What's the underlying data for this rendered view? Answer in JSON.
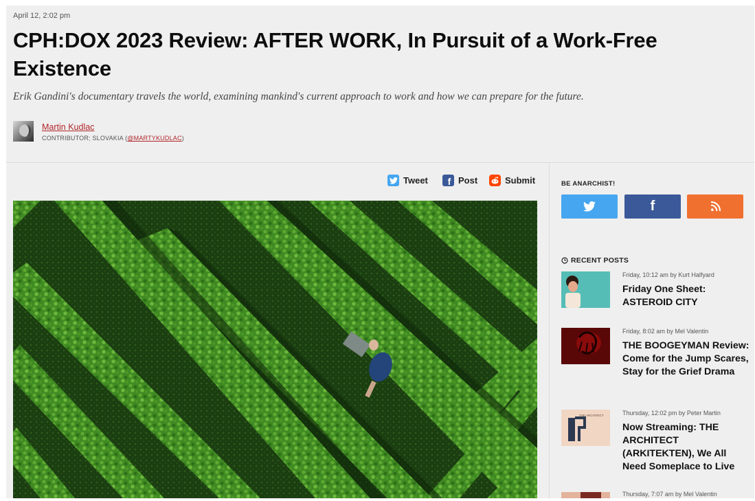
{
  "article": {
    "date": "April 12, 2:02 pm",
    "headline": "CPH:DOX 2023 Review: AFTER WORK, In Pursuit of a Work-Free Existence",
    "dek": "Erik Gandini's documentary travels the world, examining mankind's current approach to work and how we can prepare for the future.",
    "author": {
      "name": "Martin Kudlac",
      "role": "CONTRIBUTOR; SLOVAKIA (",
      "handle": "@MARTYKUDLAC",
      "role_close": ")"
    }
  },
  "share": {
    "tweet": "Tweet",
    "post": "Post",
    "submit": "Submit"
  },
  "sidebar": {
    "anarchist_heading": "BE ANARCHIST!",
    "social": [
      {
        "icon": "twitter-icon",
        "color": "#46a6ef"
      },
      {
        "icon": "facebook-icon",
        "color": "#3b5998"
      },
      {
        "icon": "rss-icon",
        "color": "#f0702f"
      }
    ],
    "recent_heading": "RECENT POSTS",
    "recent_posts": [
      {
        "meta": "Friday, 10:12 am by Kurt Halfyard",
        "title": "Friday One Sheet: ASTEROID CITY"
      },
      {
        "meta": "Friday, 8:02 am by Mel Valentin",
        "title": "THE BOOGEYMAN Review: Come for the Jump Scares, Stay for the Grief Drama"
      },
      {
        "meta": "Thursday, 12:02 pm by Peter Martin",
        "title": "Now Streaming: THE ARCHITECT (ARKITEKTEN), We All Need Someplace to Live",
        "thumb_text": "THE ARCHITECT"
      },
      {
        "meta": "Thursday, 7:07 am by Mel Valentin",
        "title": ""
      }
    ]
  },
  "colors": {
    "link_red": "#b1262a",
    "twitter": "#46a6ef",
    "facebook": "#3b5998",
    "reddit": "#ff4500",
    "rss": "#f0702f"
  }
}
